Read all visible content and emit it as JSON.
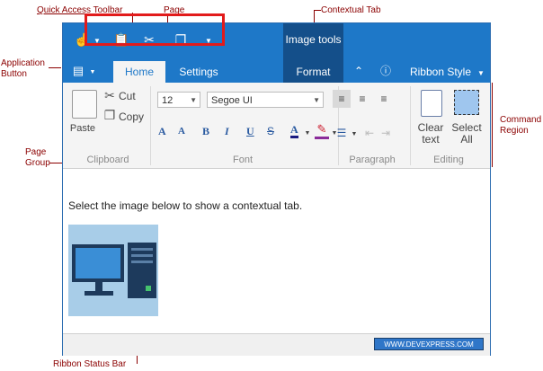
{
  "annotations": {
    "quick_access_toolbar": "Quick Access Toolbar",
    "page": "Page",
    "contextual_tab": "Contextual Tab",
    "application_button": "Application\nButton",
    "command_region": "Command\nRegion",
    "page_group": "Page\nGroup",
    "ribbon_status_bar": "Ribbon Status Bar"
  },
  "ribbon": {
    "contextual_category": "Image tools",
    "tabs": [
      {
        "label": "Home",
        "active": true
      },
      {
        "label": "Settings",
        "active": false
      },
      {
        "label": "Format",
        "active": false,
        "contextual": true
      }
    ],
    "style_label": "Ribbon Style",
    "groups": {
      "clipboard": {
        "label": "Clipboard",
        "paste": "Paste",
        "cut": "Cut",
        "copy": "Copy"
      },
      "font": {
        "label": "Font",
        "size": "12",
        "family": "Segoe UI"
      },
      "paragraph": {
        "label": "Paragraph"
      },
      "editing": {
        "label": "Editing",
        "clear_text": "Clear\ntext",
        "select_all": "Select\nAll"
      }
    }
  },
  "document": {
    "text": "Select the image below to show a contextual tab."
  },
  "status_bar": {
    "brand": "WWW.DEVEXPRESS.COM"
  },
  "colors": {
    "ribbon_blue": "#1e78c8",
    "contextual_dark": "#144f8a",
    "annotation": "#8b0000",
    "highlight_red": "#e21b1b"
  }
}
